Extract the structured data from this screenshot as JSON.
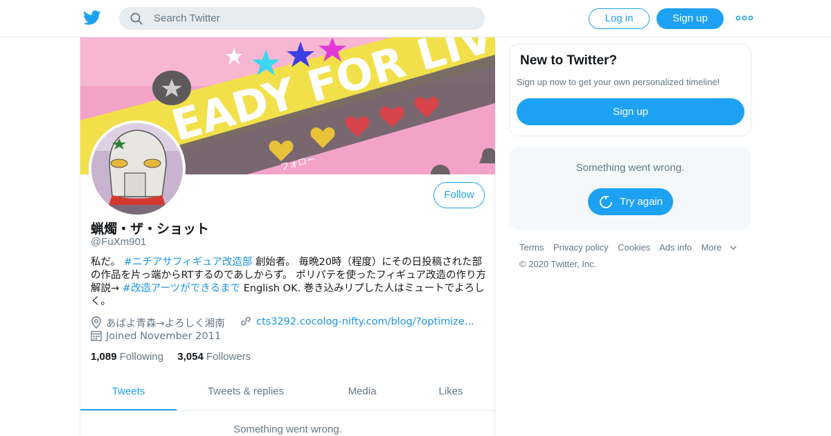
{
  "topbar": {
    "search_placeholder": "Search Twitter",
    "login_label": "Log in",
    "signup_label": "Sign up"
  },
  "banner": {
    "text": "EADY FOR LIVE",
    "sub_text": "フォロー"
  },
  "profile": {
    "display_name": "蝋燭・ザ・ショット",
    "handle": "@FuXm901",
    "follow_label": "Follow",
    "bio": {
      "p1": "私だ。 ",
      "tag1": "#ニチアサフィギュア改造部",
      "p2": " 創始者。 毎晩20時（程度）にその日投稿された部の作品を片っ端からRTするのであしからず。 ポリパテを使ったフィギュア改造の作り方解説→ ",
      "tag2": "#改造アーツができるまで",
      "p3": " English OK. 巻き込みリプした人はミュートでよろしく。"
    },
    "location": "あばよ青森→よろしく湘南",
    "website": "cts3292.cocolog-nifty.com/blog/?optimize...",
    "joined": "Joined November 2011",
    "following_count": "1,089",
    "following_label": "Following",
    "followers_count": "3,054",
    "followers_label": "Followers"
  },
  "tabs": [
    {
      "label": "Tweets",
      "active": true
    },
    {
      "label": "Tweets & replies",
      "active": false
    },
    {
      "label": "Media",
      "active": false
    },
    {
      "label": "Likes",
      "active": false
    }
  ],
  "timeline_error": "Something went wrong.",
  "sidebar": {
    "new_title": "New to Twitter?",
    "new_sub": "Sign up now to get your own personalized timeline!",
    "new_signup": "Sign up",
    "error_msg": "Something went wrong.",
    "retry_label": "Try again"
  },
  "footer": {
    "links": [
      "Terms",
      "Privacy policy",
      "Cookies",
      "Ads info",
      "More"
    ],
    "copyright": "© 2020 Twitter, Inc."
  },
  "colors": {
    "accent": "#1da1f2",
    "link": "#1b95e0",
    "muted": "#657786"
  }
}
